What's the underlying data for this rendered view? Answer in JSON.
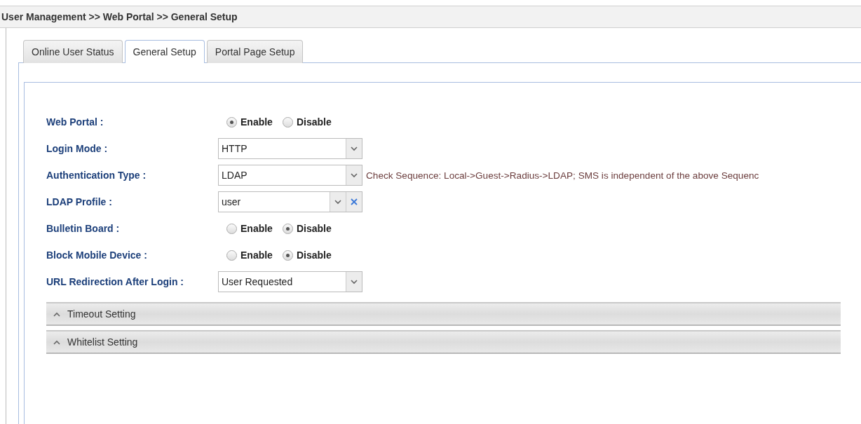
{
  "breadcrumb": "User Management >> Web Portal >> General Setup",
  "tabs": [
    {
      "label": "Online User Status",
      "selected": false
    },
    {
      "label": "General Setup",
      "selected": true
    },
    {
      "label": "Portal Page Setup",
      "selected": false
    }
  ],
  "fields": [
    {
      "kind": "radio",
      "label": "Web Portal :",
      "options": [
        {
          "label": "Enable",
          "selected": true
        },
        {
          "label": "Disable",
          "selected": false
        }
      ]
    },
    {
      "kind": "select",
      "label": "Login Mode :",
      "value": "HTTP"
    },
    {
      "kind": "select",
      "label": "Authentication Type :",
      "value": "LDAP",
      "hint": "Check Sequence: Local->Guest->Radius->LDAP; SMS is independent of the above Sequenc"
    },
    {
      "kind": "select_clear",
      "label": "LDAP Profile :",
      "value": "user"
    },
    {
      "kind": "radio",
      "label": "Bulletin Board :",
      "options": [
        {
          "label": "Enable",
          "selected": false
        },
        {
          "label": "Disable",
          "selected": true
        }
      ]
    },
    {
      "kind": "radio",
      "label": "Block Mobile Device :",
      "options": [
        {
          "label": "Enable",
          "selected": false
        },
        {
          "label": "Disable",
          "selected": true
        }
      ]
    },
    {
      "kind": "select",
      "label": "URL Redirection After Login :",
      "value": "User Requested"
    }
  ],
  "sections": [
    {
      "title": "Timeout Setting",
      "expanded": false
    },
    {
      "title": "Whitelist Setting",
      "expanded": false
    }
  ]
}
